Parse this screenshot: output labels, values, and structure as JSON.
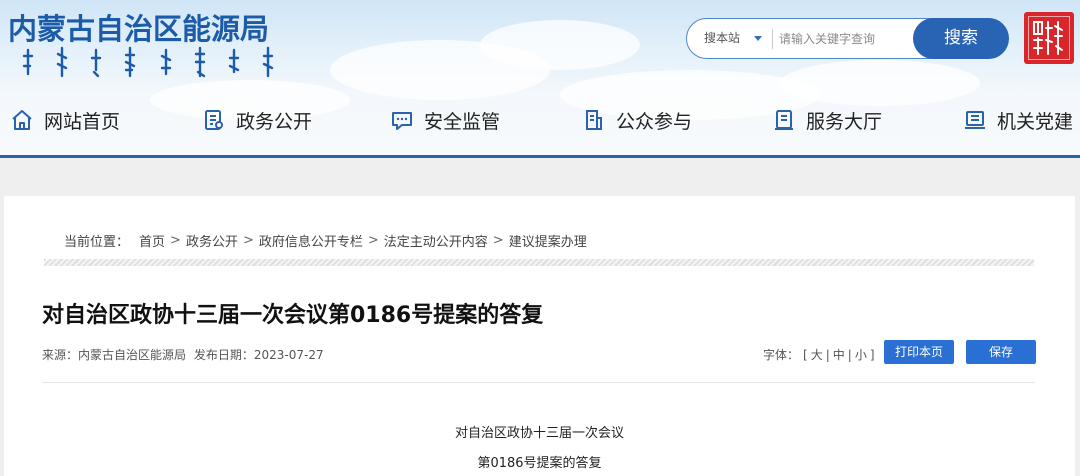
{
  "header": {
    "site_title": "内蒙古自治区能源局",
    "search": {
      "scope_label": "搜本站",
      "placeholder": "请输入关键字查询",
      "button_label": "搜索"
    },
    "emblem_icon": "inner-mongolia-seal-icon"
  },
  "nav": {
    "items": [
      {
        "label": "网站首页",
        "icon": "home-icon"
      },
      {
        "label": "政务公开",
        "icon": "document-icon"
      },
      {
        "label": "安全监管",
        "icon": "chat-bubble-icon"
      },
      {
        "label": "公众参与",
        "icon": "clipboard-icon"
      },
      {
        "label": "服务大厅",
        "icon": "book-icon"
      },
      {
        "label": "机关党建",
        "icon": "building-icon"
      }
    ],
    "accent_color": "#2b62ac"
  },
  "breadcrumb": {
    "prefix": "当前位置：",
    "items": [
      "首页",
      "政务公开",
      "政府信息公开专栏",
      "法定主动公开内容",
      "建议提案办理"
    ],
    "separator": ">"
  },
  "article": {
    "title": "对自治区政协十三届一次会议第0186号提案的答复",
    "source_label": "来源：",
    "source": "内蒙古自治区能源局",
    "date_label": "发布日期：",
    "date": "2023-07-27",
    "font_size_label": "字体：",
    "font_sizes": [
      "大",
      "中",
      "小"
    ],
    "print_label": "打印本页",
    "save_label": "保存",
    "body_lines": [
      "对自治区政协十三届一次会议",
      "第0186号提案的答复"
    ]
  },
  "colors": {
    "primary_blue": "#2864b3",
    "button_blue": "#2a6fd3",
    "emblem_red": "#d8262b"
  }
}
